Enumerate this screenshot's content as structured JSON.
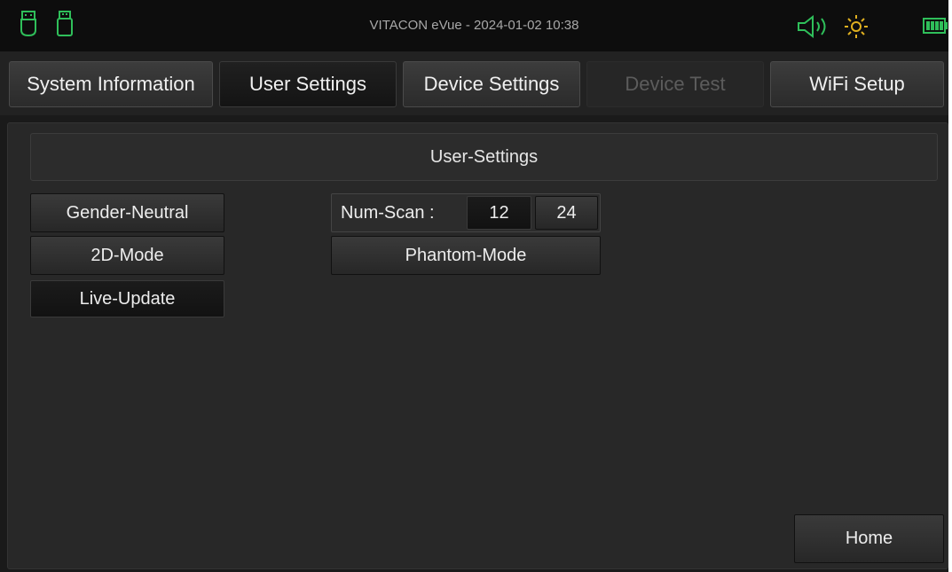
{
  "status_bar": {
    "title": "VITACON eVue - 2024-01-02 10:38",
    "icons": [
      "usb-icon",
      "usb-icon",
      "speaker-icon",
      "brightness-icon",
      "battery-icon"
    ],
    "accent_color": "#2fbf5a"
  },
  "tabs": [
    {
      "label": "System Information",
      "state": "normal"
    },
    {
      "label": "User Settings",
      "state": "active"
    },
    {
      "label": "Device Settings",
      "state": "normal"
    },
    {
      "label": "Device Test",
      "state": "disabled"
    },
    {
      "label": "WiFi Setup",
      "state": "normal"
    }
  ],
  "panel": {
    "header": "User-Settings",
    "left_buttons": [
      {
        "label": "Gender-Neutral",
        "state": "normal"
      },
      {
        "label": "2D-Mode",
        "state": "normal"
      },
      {
        "label": "Live-Update",
        "state": "pressed"
      }
    ],
    "num_scan": {
      "label": "Num-Scan :",
      "options": [
        "12",
        "24"
      ],
      "selected": "12"
    },
    "phantom_mode_label": "Phantom-Mode",
    "home_label": "Home"
  }
}
